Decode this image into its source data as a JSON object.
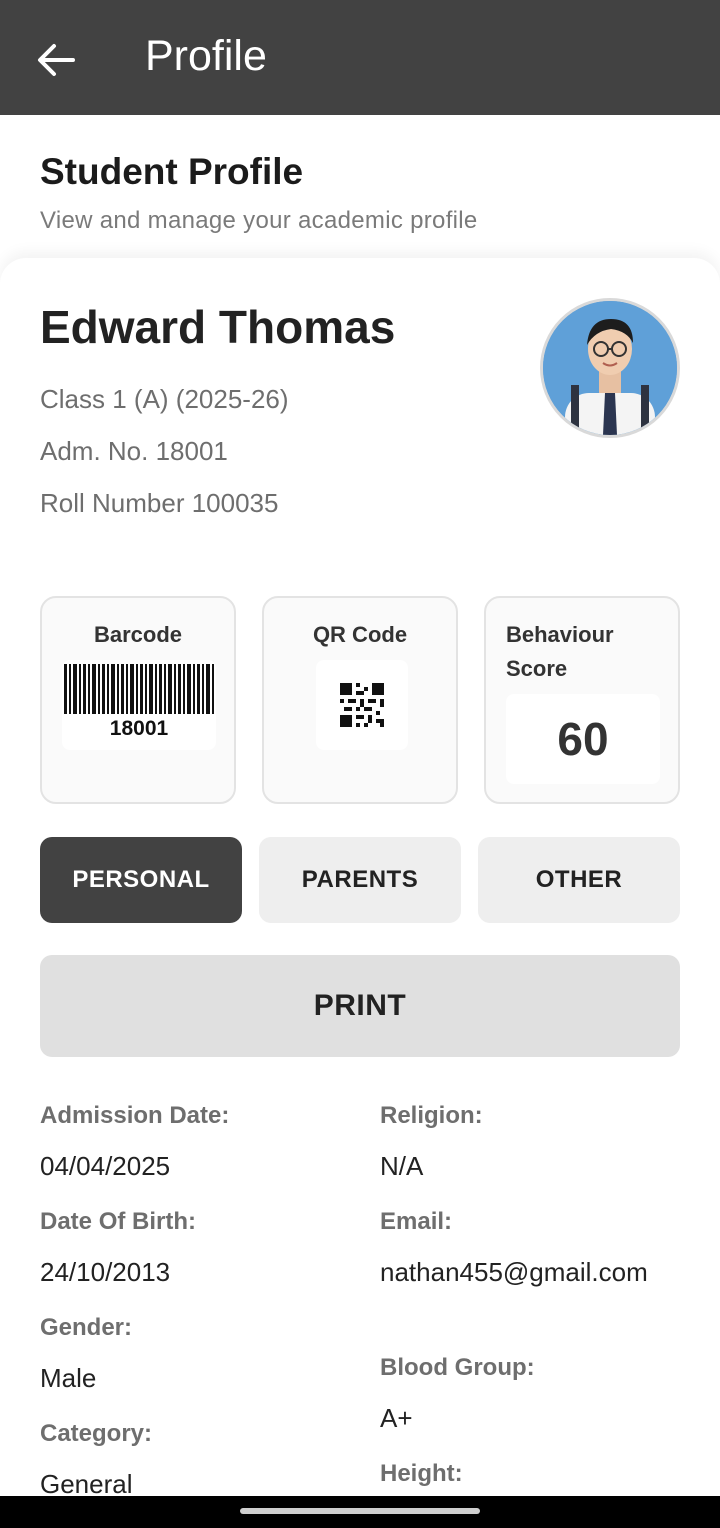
{
  "appbar": {
    "title": "Profile",
    "back_icon": "arrow-left-icon"
  },
  "header": {
    "title": "Student Profile",
    "subtitle": "View and manage your academic profile"
  },
  "student": {
    "name": "Edward Thomas",
    "class": "Class 1 (A) (2025-26)",
    "admission_no": "Adm. No. 18001",
    "roll_number": "Roll Number 100035",
    "avatar_icon": "student-photo"
  },
  "tiles": {
    "barcode": {
      "title": "Barcode",
      "value": "18001"
    },
    "qr": {
      "title": "QR Code",
      "icon": "qr-code-icon"
    },
    "behaviour": {
      "title": "Behaviour Score",
      "value": "60"
    }
  },
  "tabs": [
    {
      "label": "PERSONAL",
      "active": true
    },
    {
      "label": "PARENTS",
      "active": false
    },
    {
      "label": "OTHER",
      "active": false
    }
  ],
  "print_label": "PRINT",
  "details": {
    "left": [
      {
        "label": "Admission Date:",
        "value": "04/04/2025"
      },
      {
        "label": "Date Of Birth:",
        "value": "24/10/2013"
      },
      {
        "label": "Gender:",
        "value": "Male"
      },
      {
        "label": "Category:",
        "value": "General"
      }
    ],
    "right": [
      {
        "label": "Religion:",
        "value": "N/A"
      },
      {
        "label": "Email:",
        "value": "nathan455@gmail.com"
      },
      {
        "label": "Blood Group:",
        "value": "A+"
      },
      {
        "label": "Height:",
        "value": ""
      }
    ]
  },
  "colors": {
    "appbar": "#424242",
    "active_tab": "#424242",
    "inactive_tab": "#eeeeee",
    "print_button": "#e0e0e0"
  }
}
